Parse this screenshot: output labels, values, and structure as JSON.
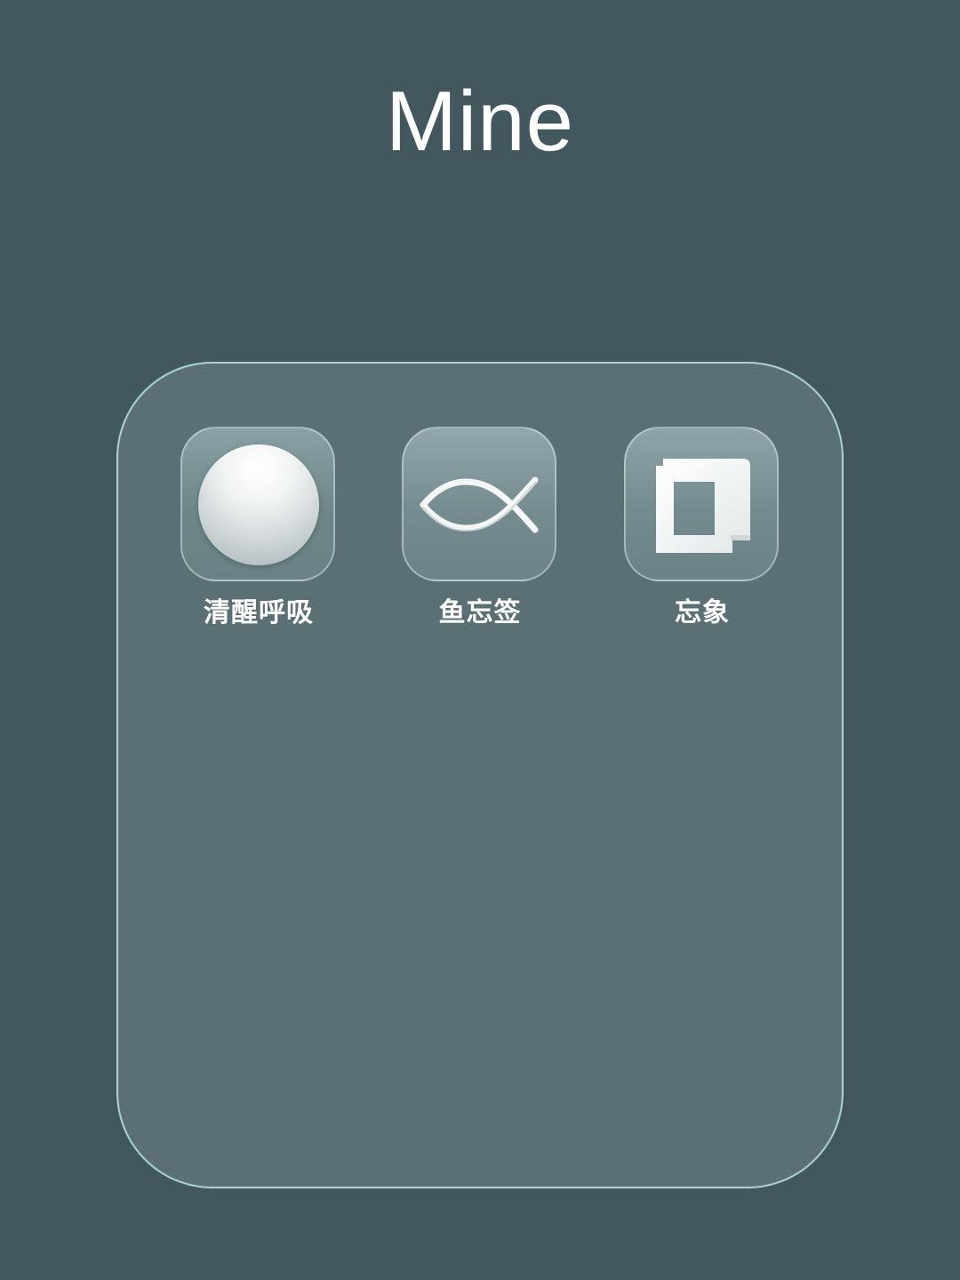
{
  "folder": {
    "title": "Mine",
    "apps": [
      {
        "label": "清醒呼吸",
        "icon": "sphere-icon"
      },
      {
        "label": "鱼忘签",
        "icon": "fish-icon"
      },
      {
        "label": "忘象",
        "icon": "square-frame-icon"
      }
    ]
  },
  "colors": {
    "background": "#43575e",
    "panel": "#5a7074",
    "panel_border": "#a9d3d2",
    "label": "#ffffff"
  }
}
